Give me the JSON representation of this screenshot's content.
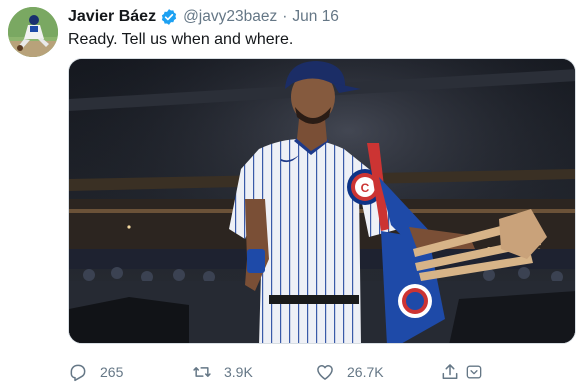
{
  "tweet": {
    "author_name": "Javier Báez",
    "handle": "@javy23baez",
    "separator": "·",
    "date": "Jun 16",
    "text": "Ready. Tell us when and where.",
    "media_jersey_logo": "C"
  },
  "actions": {
    "reply_count": "265",
    "retweet_count": "3.9K",
    "like_count": "26.7K"
  },
  "icons": {
    "verified": "verified-badge-icon",
    "reply": "reply-icon",
    "retweet": "retweet-icon",
    "like": "heart-icon",
    "share": "share-icon"
  },
  "colors": {
    "verified_blue": "#1da1f2",
    "secondary_text": "#657786",
    "cubs_blue": "#0e3386",
    "cubs_red": "#cc3433"
  }
}
